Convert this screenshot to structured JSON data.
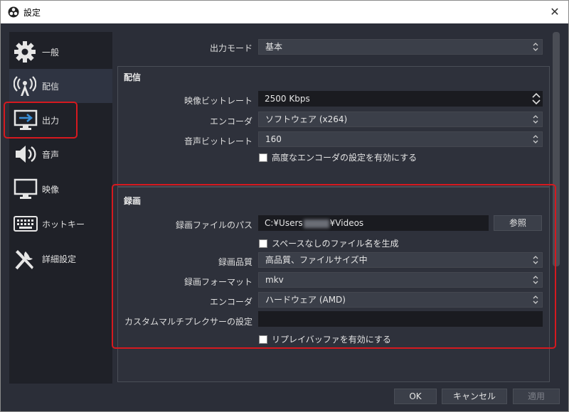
{
  "window": {
    "title": "設定",
    "close_icon": "close-icon"
  },
  "sidebar": {
    "items": [
      {
        "label": "一般",
        "icon": "gear-icon"
      },
      {
        "label": "配信",
        "icon": "broadcast-icon"
      },
      {
        "label": "出力",
        "icon": "output-icon"
      },
      {
        "label": "音声",
        "icon": "speaker-icon"
      },
      {
        "label": "映像",
        "icon": "monitor-icon"
      },
      {
        "label": "ホットキー",
        "icon": "keyboard-icon"
      },
      {
        "label": "詳細設定",
        "icon": "tools-icon"
      }
    ]
  },
  "output_mode": {
    "label": "出力モード",
    "value": "基本"
  },
  "streaming": {
    "title": "配信",
    "video_bitrate": {
      "label": "映像ビットレート",
      "value": "2500 Kbps"
    },
    "encoder": {
      "label": "エンコーダ",
      "value": "ソフトウェア (x264)"
    },
    "audio_bitrate": {
      "label": "音声ビットレート",
      "value": "160"
    },
    "advanced_encoder": {
      "label": "高度なエンコーダの設定を有効にする"
    }
  },
  "recording": {
    "title": "録画",
    "path": {
      "label": "録画ファイルのパス",
      "value_prefix": "C:¥Users",
      "value_suffix": "¥Videos",
      "browse": "参照"
    },
    "no_space": {
      "label": "スペースなしのファイル名を生成"
    },
    "quality": {
      "label": "録画品質",
      "value": "高品質、ファイルサイズ中"
    },
    "format": {
      "label": "録画フォーマット",
      "value": "mkv"
    },
    "encoder": {
      "label": "エンコーダ",
      "value": "ハードウェア (AMD)"
    },
    "muxer": {
      "label": "カスタムマルチプレクサーの設定",
      "value": ""
    },
    "replay_buffer": {
      "label": "リプレイバッファを有効にする"
    }
  },
  "footer": {
    "ok": "OK",
    "cancel": "キャンセル",
    "apply": "適用"
  },
  "colors": {
    "highlight": "#d6191f",
    "panel": "#2b2e38",
    "sidebar": "#1f2128"
  }
}
